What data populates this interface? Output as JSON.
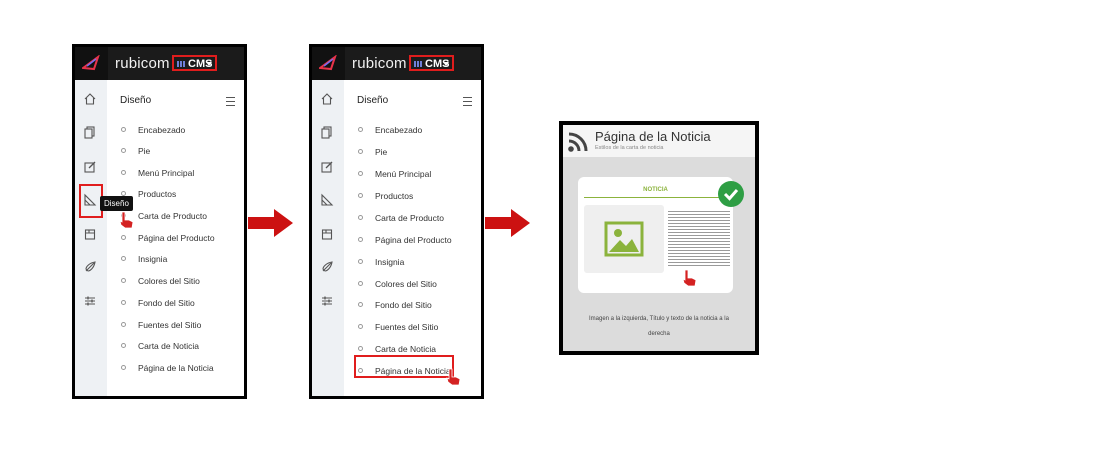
{
  "app": {
    "brand": "rubicom",
    "module": "CMS"
  },
  "menu": {
    "title": "Diseño",
    "items": [
      "Encabezado",
      "Pie",
      "Menú Principal",
      "Productos",
      "Carta de Producto",
      "Página del Producto",
      "Insignia",
      "Colores del Sitio",
      "Fondo del Sitio",
      "Fuentes del Sitio",
      "Carta de Noticia",
      "Página de la Noticia"
    ]
  },
  "sidebar_icons": [
    "home-icon",
    "pages-icon",
    "edit-icon",
    "design-icon",
    "box-icon",
    "rocket-icon",
    "settings-icon"
  ],
  "tooltip": "Diseño",
  "result": {
    "title": "Página de la Noticia",
    "subtitle": "Estilos de la carta de noticia",
    "preview_label": "NOTICIA",
    "caption_line1": "Imagen a la izquierda, Título y texto de la noticia a la",
    "caption_line2": "derecha"
  },
  "colors": {
    "highlight": "#e01d1d",
    "arrow": "#cc1111",
    "accent_green": "#8bb33c",
    "check": "#2e9e44"
  }
}
